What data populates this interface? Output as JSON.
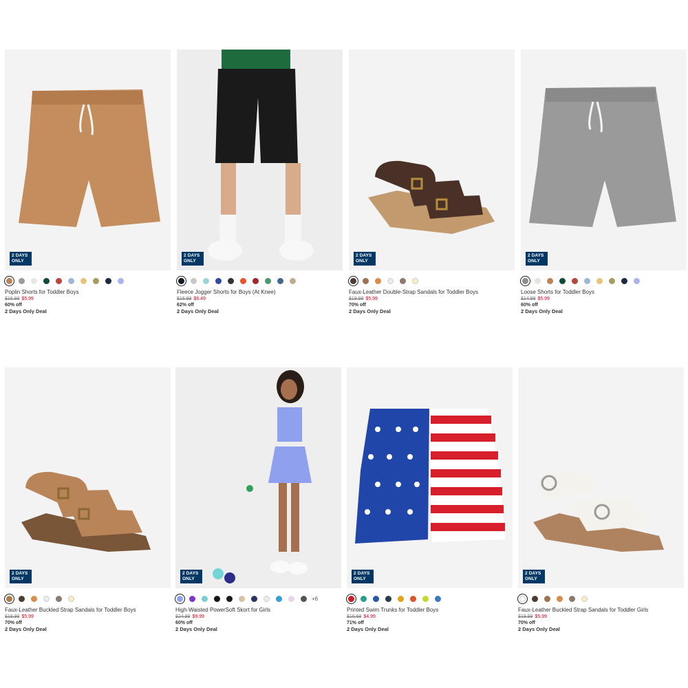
{
  "products": [
    {
      "name": "Poplin Shorts for Toddler Boys",
      "badge": "2 DAYS ONLY",
      "old_price": "$16.99",
      "new_price": "$5.99",
      "discount": "60% off",
      "deal": "2 Days Only Deal",
      "swatches": [
        "#b98458",
        "#9a9a9a",
        "#e9e7e2",
        "#0f4a37",
        "#b8463a",
        "#9fb6d6",
        "#e8c47a",
        "#a79d5d",
        "#1d2a44",
        "#a9b3ee"
      ],
      "more": ""
    },
    {
      "name": "Fleece Jogger Shorts for Boys (At Knee)",
      "badge": "2 DAYS ONLY",
      "old_price": "$16.99",
      "new_price": "$6.49",
      "discount": "62% off",
      "deal": "2 Days Only Deal",
      "swatches": [
        "#151a26",
        "#c8c8c8",
        "#9fd4dc",
        "#2d49a9",
        "#333333",
        "#f0532b",
        "#a0282c",
        "#4d9872",
        "#43688f",
        "#c3ab90"
      ],
      "more": ""
    },
    {
      "name": "Faux-Leather Double-Strap Sandals for Toddler Boys",
      "badge": "2 DAYS ONLY",
      "old_price": "$19.99",
      "new_price": "$5.99",
      "discount": "70% off",
      "deal": "2 Days Only Deal",
      "swatches": [
        "#4e3b35",
        "#9b7354",
        "#d88d4b",
        "#ececec",
        "#8c7b6f",
        "#f9edc4"
      ],
      "more": ""
    },
    {
      "name": "Loose Shorts for Toddler Boys",
      "badge": "2 DAYS ONLY",
      "old_price": "$14.99",
      "new_price": "$5.99",
      "discount": "60% off",
      "deal": "2 Days Only Deal",
      "swatches": [
        "#8d8d8d",
        "#e4e2dc",
        "#b98458",
        "#0f4a37",
        "#b8463a",
        "#9fb6d6",
        "#e8c47a",
        "#a79d5d",
        "#1d2a44",
        "#a9b3ee"
      ],
      "more": ""
    },
    {
      "name": "Faux-Leather Buckled Strap Sandals for Toddler Boys",
      "badge": "2 DAYS ONLY",
      "old_price": "$19.99",
      "new_price": "$5.99",
      "discount": "70% off",
      "deal": "2 Days Only Deal",
      "swatches": [
        "#b07a4c",
        "#4e3b35",
        "#d88d4b",
        "#ececec",
        "#8c7b6f",
        "#f9edc4"
      ],
      "more": ""
    },
    {
      "name": "High-Waisted PowerSoft Skort for Girls",
      "badge": "2 DAYS ONLY",
      "old_price": "$24.99",
      "new_price": "$9.99",
      "discount": "60% off",
      "deal": "2 Days Only Deal",
      "swatches": [
        "#8fa3ef",
        "#7b37c6",
        "#78d0cf",
        "#151515",
        "#1a1a1a",
        "#d9c3a8",
        "#2a3366",
        "#ececec",
        "#35a0d8",
        "#e7d7e6",
        "#555555"
      ],
      "more": "+6"
    },
    {
      "name": "Printed Swim Trunks for Toddler Boys",
      "badge": "2 DAYS ONLY",
      "old_price": "$16.99",
      "new_price": "$4.99",
      "discount": "71% off",
      "deal": "2 Days Only Deal",
      "swatches": [
        "#c82028",
        "#2a9d8f",
        "#2b55a5",
        "#2a3a4a",
        "#e3a21a",
        "#d9552a",
        "#c6d72e",
        "#3c7bbf"
      ],
      "more": ""
    },
    {
      "name": "Faux-Leather Buckled Strap Sandals for Toddler Girls",
      "badge": "2 DAYS ONLY",
      "old_price": "$19.99",
      "new_price": "$5.99",
      "discount": "70% off",
      "deal": "2 Days Only Deal",
      "swatches": [
        "#ffffff",
        "#4e3b35",
        "#9b7354",
        "#d88d4b",
        "#8c7b6f",
        "#f9edc4"
      ],
      "more": ""
    }
  ]
}
